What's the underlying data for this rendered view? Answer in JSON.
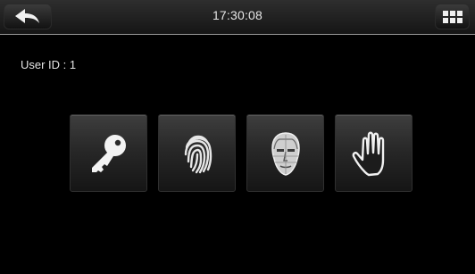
{
  "header": {
    "time": "17:30:08",
    "back_icon": "back-arrow-icon",
    "menu_icon": "grid-menu-icon"
  },
  "user": {
    "id_label": "User ID : 1"
  },
  "verify_methods": [
    {
      "name": "password",
      "icon": "key-icon"
    },
    {
      "name": "fingerprint",
      "icon": "fingerprint-icon"
    },
    {
      "name": "face",
      "icon": "face-icon"
    },
    {
      "name": "palm",
      "icon": "palm-icon"
    }
  ],
  "colors": {
    "background": "#000000",
    "text": "#e6e6e6",
    "header_divider": "#9a9a9a"
  }
}
